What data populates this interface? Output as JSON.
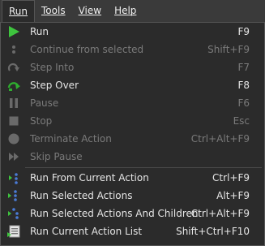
{
  "menubar": {
    "items": [
      {
        "label": "Run"
      },
      {
        "label": "Tools"
      },
      {
        "label": "View"
      },
      {
        "label": "Help"
      }
    ]
  },
  "menu": {
    "items": [
      {
        "label": "Run",
        "shortcut": "F9",
        "icon": "play-icon",
        "enabled": true
      },
      {
        "label": "Continue from selected",
        "shortcut": "Shift+F9",
        "icon": "continue-dots-icon",
        "enabled": false
      },
      {
        "label": "Step Into",
        "shortcut": "F7",
        "icon": "step-into-icon",
        "enabled": false
      },
      {
        "label": "Step Over",
        "shortcut": "F8",
        "icon": "step-over-icon",
        "enabled": true
      },
      {
        "label": "Pause",
        "shortcut": "F6",
        "icon": "pause-icon",
        "enabled": false
      },
      {
        "label": "Stop",
        "shortcut": "Esc",
        "icon": "stop-icon",
        "enabled": false
      },
      {
        "label": "Terminate Action",
        "shortcut": "Ctrl+Alt+F9",
        "icon": "terminate-icon",
        "enabled": false
      },
      {
        "label": "Skip Pause",
        "shortcut": "",
        "icon": "skip-pause-icon",
        "enabled": false
      },
      {
        "label": "Run From Current Action",
        "shortcut": "Ctrl+F9",
        "icon": "run-from-current-icon",
        "enabled": true
      },
      {
        "label": "Run Selected Actions",
        "shortcut": "Alt+F9",
        "icon": "run-selected-icon",
        "enabled": true
      },
      {
        "label": "Run Selected Actions And Children",
        "shortcut": "Ctrl+Alt+F9",
        "icon": "run-selected-children-icon",
        "enabled": true
      },
      {
        "label": "Run Current Action List",
        "shortcut": "Shift+Ctrl+F10",
        "icon": "run-action-list-icon",
        "enabled": true
      }
    ]
  },
  "colors": {
    "play": "#3ec43e",
    "stepOver": "#2fae2f",
    "actionDots": "#4a7bd6",
    "disabledIcon": "#6a6a6a"
  }
}
